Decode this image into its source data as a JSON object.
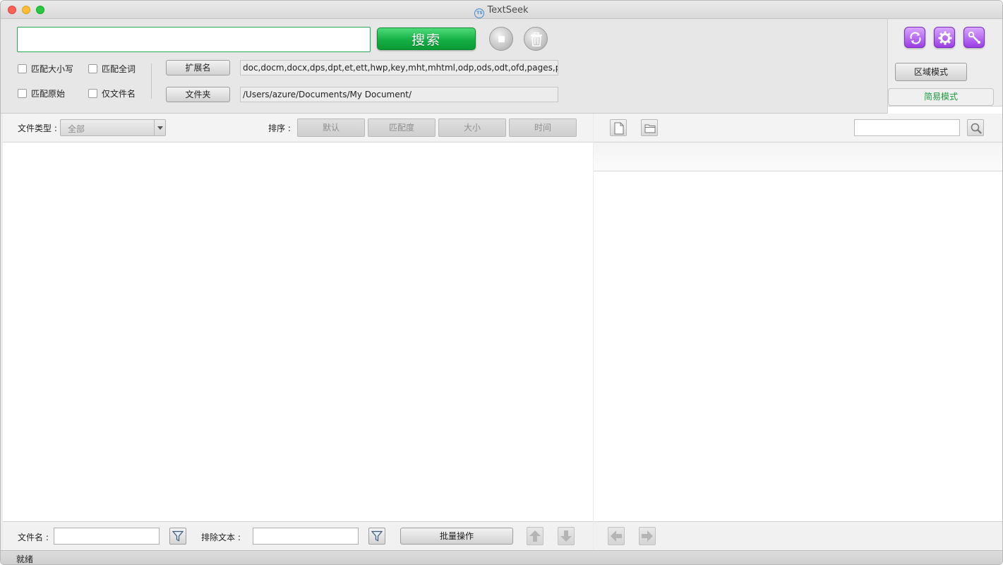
{
  "window": {
    "title": "TextSeek",
    "app_icon_text": "TS"
  },
  "search": {
    "query": "",
    "button_label": "搜索"
  },
  "options": {
    "match_case": "匹配大小写",
    "match_whole_word": "匹配全词",
    "match_original": "匹配原始",
    "filename_only": "仅文件名"
  },
  "scope": {
    "ext_button": "扩展名",
    "ext_value": "doc,docm,docx,dps,dpt,et,ett,hwp,key,mht,mhtml,odp,ods,odt,ofd,pages,pdf,ppt,pptm",
    "folder_button": "文件夹",
    "folder_value": "/Users/azure/Documents/My Document/"
  },
  "modes": {
    "region": "区域模式",
    "simple": "简易模式"
  },
  "results_toolbar": {
    "file_type_label": "文件类型 :",
    "file_type_value": "全部",
    "sort_label": "排序 :",
    "sort_options": [
      "默认",
      "匹配度",
      "大小",
      "时间"
    ]
  },
  "results_footer": {
    "filename_label": "文件名 :",
    "exclude_label": "排除文本 :",
    "batch_button": "批量操作"
  },
  "status": {
    "text": "就绪"
  },
  "colors": {
    "accent_green": "#15b045",
    "purple": "#9b3fe4"
  }
}
